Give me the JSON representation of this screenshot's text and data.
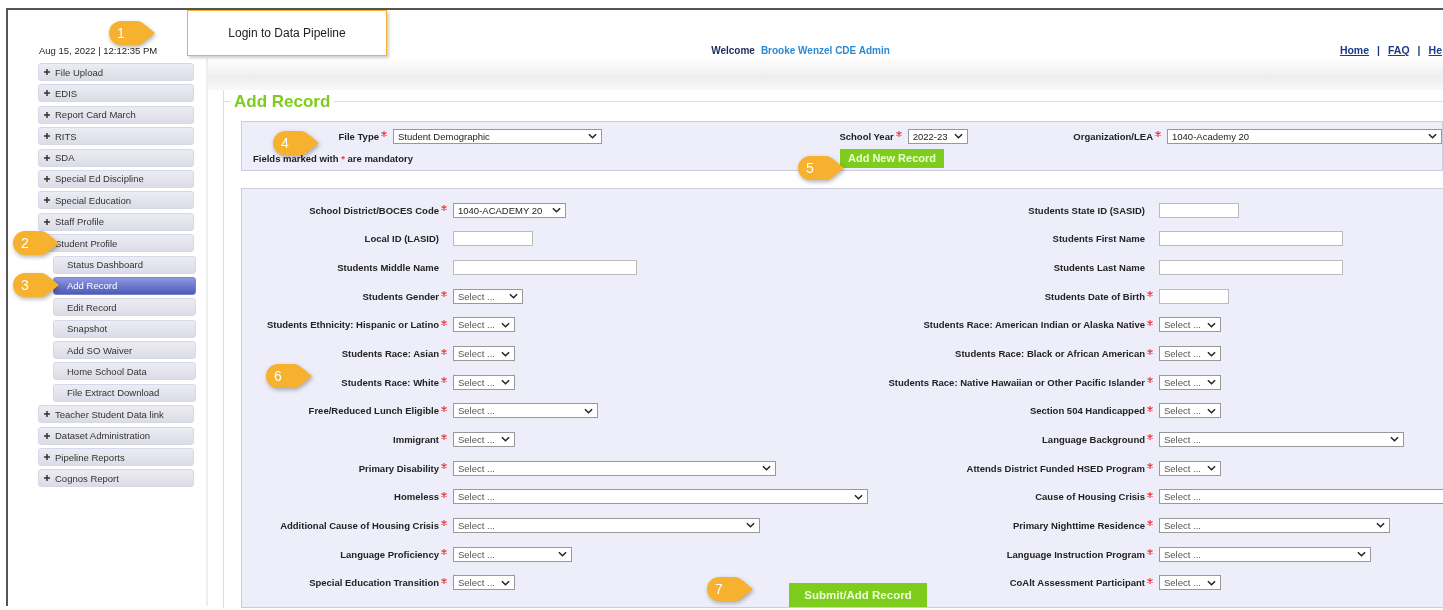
{
  "header": {
    "datetime": "Aug 15, 2022 | 12:12:35 PM",
    "welcome": "Welcome",
    "user": "Brooke Wenzel CDE Admin",
    "links": [
      "Home",
      "FAQ",
      "He"
    ],
    "separators": [
      "|",
      "|"
    ]
  },
  "login_tip": "Login to Data Pipeline",
  "callouts": [
    "1",
    "2",
    "3",
    "4",
    "5",
    "6",
    "7"
  ],
  "sidebar": {
    "items": [
      {
        "label": "File Upload",
        "expanded": false
      },
      {
        "label": "EDIS",
        "expanded": false
      },
      {
        "label": "Report Card March",
        "expanded": false
      },
      {
        "label": "RITS",
        "expanded": false
      },
      {
        "label": "SDA",
        "expanded": false
      },
      {
        "label": "Special Ed Discipline",
        "expanded": false
      },
      {
        "label": "Special Education",
        "expanded": false
      },
      {
        "label": "Staff Profile",
        "expanded": false
      },
      {
        "label": "Student Profile",
        "expanded": true,
        "children": [
          {
            "label": "Status Dashboard",
            "selected": false
          },
          {
            "label": "Add Record",
            "selected": true
          },
          {
            "label": "Edit Record",
            "selected": false
          },
          {
            "label": "Snapshot",
            "selected": false
          },
          {
            "label": "Add SO Waiver",
            "selected": false
          },
          {
            "label": "Home School Data",
            "selected": false
          },
          {
            "label": "File Extract Download",
            "selected": false
          }
        ]
      },
      {
        "label": "Teacher Student Data link",
        "expanded": false
      },
      {
        "label": "Dataset Administration",
        "expanded": false
      },
      {
        "label": "Pipeline Reports",
        "expanded": false
      },
      {
        "label": "Cognos Report",
        "expanded": false
      }
    ]
  },
  "page_title": "Add Record",
  "selection": {
    "file_type": {
      "label": "File Type",
      "required": true,
      "value": "Student Demographic"
    },
    "school_year": {
      "label": "School Year",
      "required": true,
      "value": "2022-23"
    },
    "organization": {
      "label": "Organization/LEA",
      "required": true,
      "value": "1040-Academy 20"
    },
    "note": [
      "Fields marked with",
      "*",
      "are mandatory"
    ],
    "add_button": "Add New Record"
  },
  "form": {
    "left": [
      {
        "label": "School District/BOCES Code",
        "required": true,
        "kind": "select",
        "value": "1040-ACADEMY 20"
      },
      {
        "label": "Local ID (LASID)",
        "required": false,
        "kind": "text"
      },
      {
        "label": "Students Middle Name",
        "required": false,
        "kind": "text"
      },
      {
        "label": "Students Gender",
        "required": true,
        "kind": "select",
        "value": "Select ..."
      },
      {
        "label": "Students Ethnicity: Hispanic or Latino",
        "required": true,
        "kind": "select",
        "value": "Select ..."
      },
      {
        "label": "Students Race: Asian",
        "required": true,
        "kind": "select",
        "value": "Select ..."
      },
      {
        "label": "Students Race: White",
        "required": true,
        "kind": "select",
        "value": "Select ..."
      },
      {
        "label": "Free/Reduced Lunch Eligible",
        "required": true,
        "kind": "select",
        "value": "Select ..."
      },
      {
        "label": "Immigrant",
        "required": true,
        "kind": "select",
        "value": "Select ..."
      },
      {
        "label": "Primary Disability",
        "required": true,
        "kind": "select",
        "value": "Select ..."
      },
      {
        "label": "Homeless",
        "required": true,
        "kind": "select",
        "value": "Select ..."
      },
      {
        "label": "Additional Cause of Housing Crisis",
        "required": true,
        "kind": "select",
        "value": "Select ..."
      },
      {
        "label": "Language Proficiency",
        "required": true,
        "kind": "select",
        "value": "Select ..."
      },
      {
        "label": "Special Education Transition",
        "required": true,
        "kind": "select",
        "value": "Select ..."
      }
    ],
    "right": [
      {
        "label": "Students State ID (SASID)",
        "required": false,
        "kind": "text"
      },
      {
        "label": "Students First Name",
        "required": false,
        "kind": "text"
      },
      {
        "label": "Students Last Name",
        "required": false,
        "kind": "text"
      },
      {
        "label": "Students Date of Birth",
        "required": true,
        "kind": "text"
      },
      {
        "label": "Students Race: American Indian or Alaska Native",
        "required": true,
        "kind": "select",
        "value": "Select ..."
      },
      {
        "label": "Students Race: Black or African American",
        "required": true,
        "kind": "select",
        "value": "Select ..."
      },
      {
        "label": "Students Race: Native Hawaiian or Other Pacific Islander",
        "required": true,
        "kind": "select",
        "value": "Select ..."
      },
      {
        "label": "Section 504 Handicapped",
        "required": true,
        "kind": "select",
        "value": "Select ..."
      },
      {
        "label": "Language Background",
        "required": true,
        "kind": "select",
        "value": "Select ..."
      },
      {
        "label": "Attends District Funded HSED Program",
        "required": true,
        "kind": "select",
        "value": "Select ..."
      },
      {
        "label": "Cause of Housing Crisis",
        "required": true,
        "kind": "select",
        "value": "Select ..."
      },
      {
        "label": "Primary Nighttime Residence",
        "required": true,
        "kind": "select",
        "value": "Select ..."
      },
      {
        "label": "Language Instruction Program",
        "required": true,
        "kind": "select",
        "value": "Select ..."
      },
      {
        "label": "CoAlt Assessment Participant",
        "required": true,
        "kind": "select",
        "value": "Select ..."
      }
    ],
    "submit_button": "Submit/Add Record"
  }
}
